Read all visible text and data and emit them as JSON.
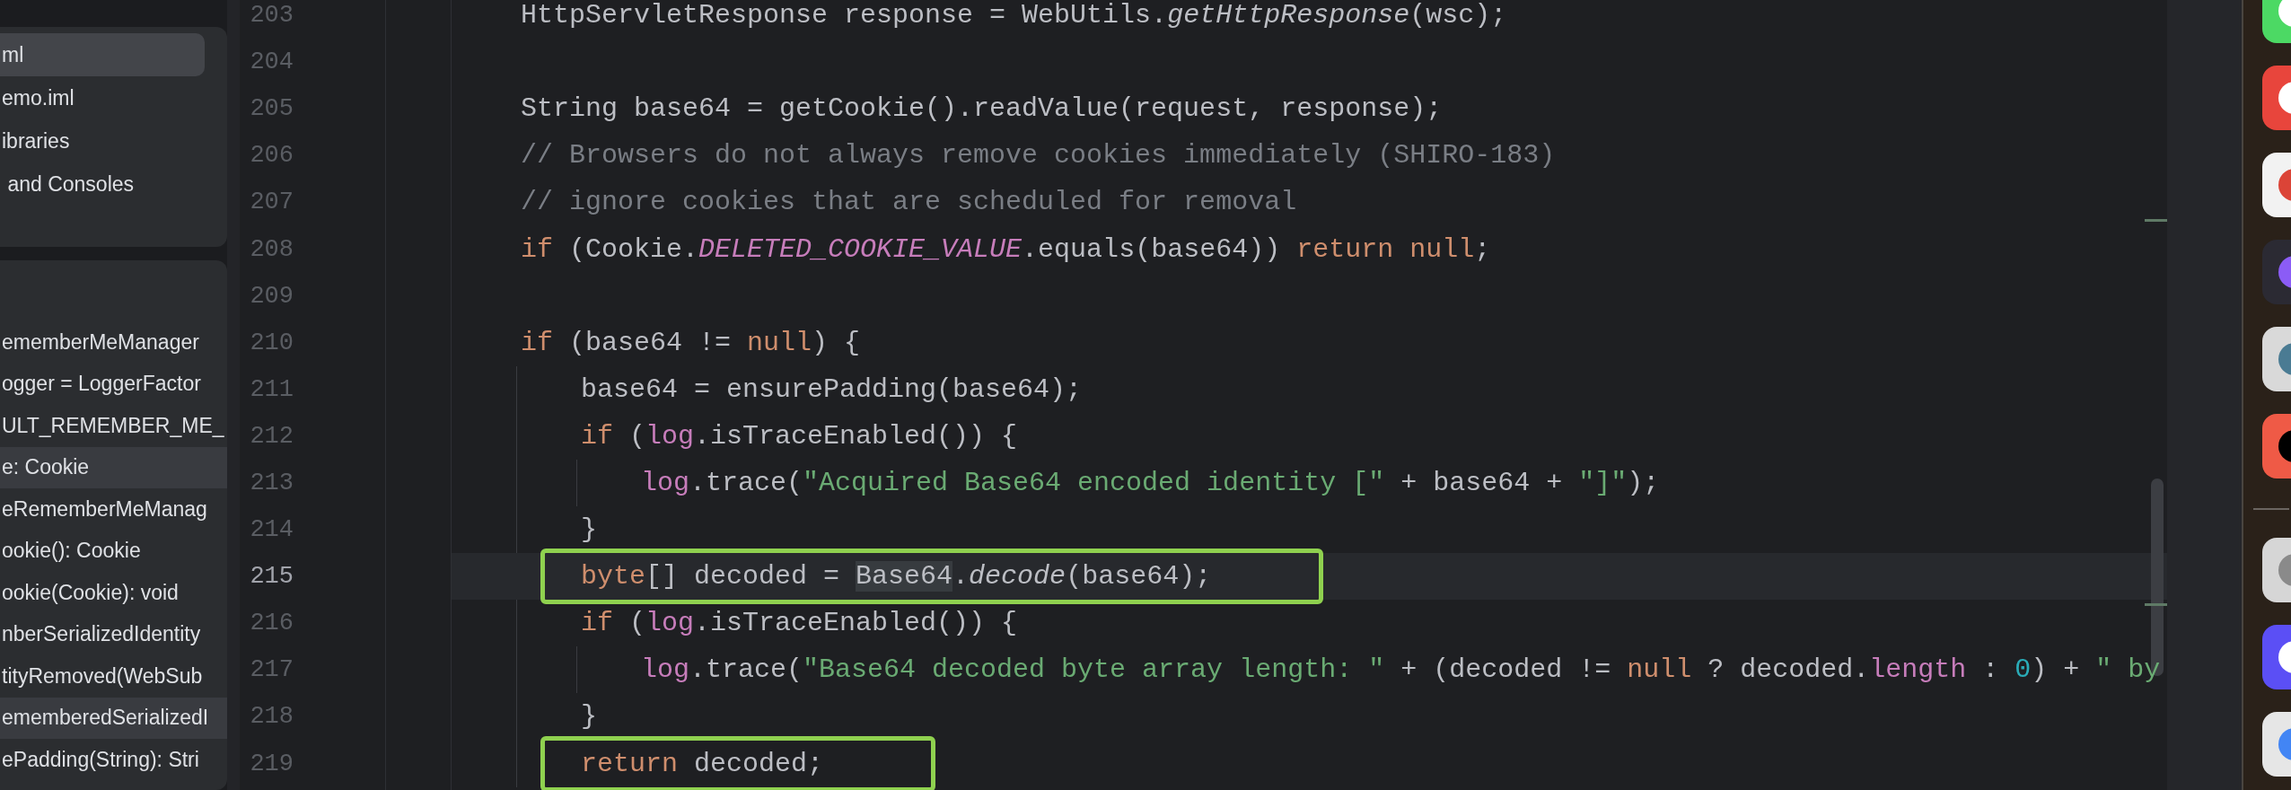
{
  "project_panel": {
    "items": [
      {
        "text": "ml",
        "selected": true
      },
      {
        "text": "emo.iml",
        "selected": false
      },
      {
        "text": "ibraries",
        "selected": false
      },
      {
        "text": " and Consoles",
        "selected": false
      }
    ]
  },
  "structure_panel": {
    "items": [
      {
        "text": "ememberMeManager",
        "selected": false
      },
      {
        "text": "ogger = LoggerFactor",
        "selected": false
      },
      {
        "text": "ULT_REMEMBER_ME_",
        "selected": false
      },
      {
        "text": "e: Cookie",
        "selected": true
      },
      {
        "text": "eRememberMeManag",
        "selected": false
      },
      {
        "text": "ookie(): Cookie",
        "selected": false
      },
      {
        "text": "ookie(Cookie): void",
        "selected": false
      },
      {
        "text": "nberSerializedIdentity",
        "selected": false
      },
      {
        "text": "tityRemoved(WebSub",
        "selected": false
      },
      {
        "text": "ememberedSerializedI",
        "selected": true
      },
      {
        "text": "ePadding(String): Stri",
        "selected": false
      }
    ]
  },
  "editor": {
    "lines": [
      {
        "number": "203",
        "current": false,
        "boxed": false,
        "tokens": [
          {
            "kind": "plain",
            "text": "HttpServletResponse response = WebUtils."
          },
          {
            "kind": "method",
            "text": "getHttpResponse"
          },
          {
            "kind": "plain",
            "text": "(wsc);"
          }
        ]
      },
      {
        "number": "204",
        "current": false,
        "boxed": false
      },
      {
        "number": "205",
        "current": false,
        "boxed": false,
        "tokens": [
          {
            "kind": "plain",
            "text": "String base64 = getCookie().readValue(request, response);"
          }
        ]
      },
      {
        "number": "206",
        "current": false,
        "boxed": false,
        "tokens": [
          {
            "kind": "comment",
            "text": "// Browsers do not always remove cookies immediately (SHIRO-183)"
          }
        ]
      },
      {
        "number": "207",
        "current": false,
        "boxed": false,
        "tokens": [
          {
            "kind": "comment",
            "text": "// ignore cookies that are scheduled for removal"
          }
        ]
      },
      {
        "number": "208",
        "current": false,
        "boxed": false,
        "tokens": [
          {
            "kind": "keyword",
            "text": "if"
          },
          {
            "kind": "plain",
            "text": " (Cookie."
          },
          {
            "kind": "constant",
            "text": "DELETED_COOKIE_VALUE"
          },
          {
            "kind": "plain",
            "text": ".equals(base64)) "
          },
          {
            "kind": "keyword",
            "text": "return null"
          },
          {
            "kind": "plain",
            "text": ";"
          }
        ]
      },
      {
        "number": "209",
        "current": false,
        "boxed": false
      },
      {
        "number": "210",
        "current": false,
        "boxed": false,
        "tokens": [
          {
            "kind": "keyword",
            "text": "if"
          },
          {
            "kind": "plain",
            "text": " (base64 != "
          },
          {
            "kind": "keyword",
            "text": "null"
          },
          {
            "kind": "plain",
            "text": ") {"
          }
        ],
        "children": [
          {
            "number": "211",
            "current": false,
            "boxed": false,
            "tokens": [
              {
                "kind": "plain",
                "text": "base64 = ensurePadding(base64);"
              }
            ]
          },
          {
            "number": "212",
            "current": false,
            "boxed": false,
            "tokens": [
              {
                "kind": "keyword",
                "text": "if"
              },
              {
                "kind": "plain",
                "text": " ("
              },
              {
                "kind": "field",
                "text": "log"
              },
              {
                "kind": "plain",
                "text": ".isTraceEnabled()) {"
              }
            ],
            "children": [
              {
                "number": "213",
                "current": false,
                "boxed": false,
                "tokens": [
                  {
                    "kind": "field",
                    "text": "log"
                  },
                  {
                    "kind": "plain",
                    "text": ".trace("
                  },
                  {
                    "kind": "string",
                    "text": "\"Acquired Base64 encoded identity [\""
                  },
                  {
                    "kind": "plain",
                    "text": " + base64 + "
                  },
                  {
                    "kind": "string",
                    "text": "\"]\""
                  },
                  {
                    "kind": "plain",
                    "text": ");"
                  }
                ]
              }
            ]
          },
          {
            "number": "214",
            "current": false,
            "boxed": false,
            "tokens": [
              {
                "kind": "plain",
                "text": "}"
              }
            ]
          },
          {
            "number": "215",
            "current": true,
            "boxed": true,
            "tokens": [
              {
                "kind": "keyword",
                "text": "byte"
              },
              {
                "kind": "plain",
                "text": "[] decoded = "
              },
              {
                "kind": "usage",
                "text": "Base64"
              },
              {
                "kind": "plain",
                "text": "."
              },
              {
                "kind": "method",
                "text": "decode"
              },
              {
                "kind": "plain",
                "text": "(base64);"
              }
            ]
          },
          {
            "number": "216",
            "current": false,
            "boxed": false,
            "tokens": [
              {
                "kind": "keyword",
                "text": "if"
              },
              {
                "kind": "plain",
                "text": " ("
              },
              {
                "kind": "field",
                "text": "log"
              },
              {
                "kind": "plain",
                "text": ".isTraceEnabled()) {"
              }
            ],
            "children": [
              {
                "number": "217",
                "current": false,
                "boxed": false,
                "tokens": [
                  {
                    "kind": "field",
                    "text": "log"
                  },
                  {
                    "kind": "plain",
                    "text": ".trace("
                  },
                  {
                    "kind": "string",
                    "text": "\"Base64 decoded byte array length: \""
                  },
                  {
                    "kind": "plain",
                    "text": " + (decoded != "
                  },
                  {
                    "kind": "keyword",
                    "text": "null"
                  },
                  {
                    "kind": "plain",
                    "text": " ? decoded."
                  },
                  {
                    "kind": "field",
                    "text": "length"
                  },
                  {
                    "kind": "plain",
                    "text": " : "
                  },
                  {
                    "kind": "number",
                    "text": "0"
                  },
                  {
                    "kind": "plain",
                    "text": ") + "
                  },
                  {
                    "kind": "string",
                    "text": "\" by"
                  }
                ]
              }
            ]
          },
          {
            "number": "218",
            "current": false,
            "boxed": false,
            "tokens": [
              {
                "kind": "plain",
                "text": "}"
              }
            ]
          },
          {
            "number": "219",
            "current": false,
            "boxed": true,
            "tokens": [
              {
                "kind": "keyword",
                "text": "return"
              },
              {
                "kind": "plain",
                "text": " decoded;"
              }
            ]
          }
        ]
      }
    ]
  }
}
